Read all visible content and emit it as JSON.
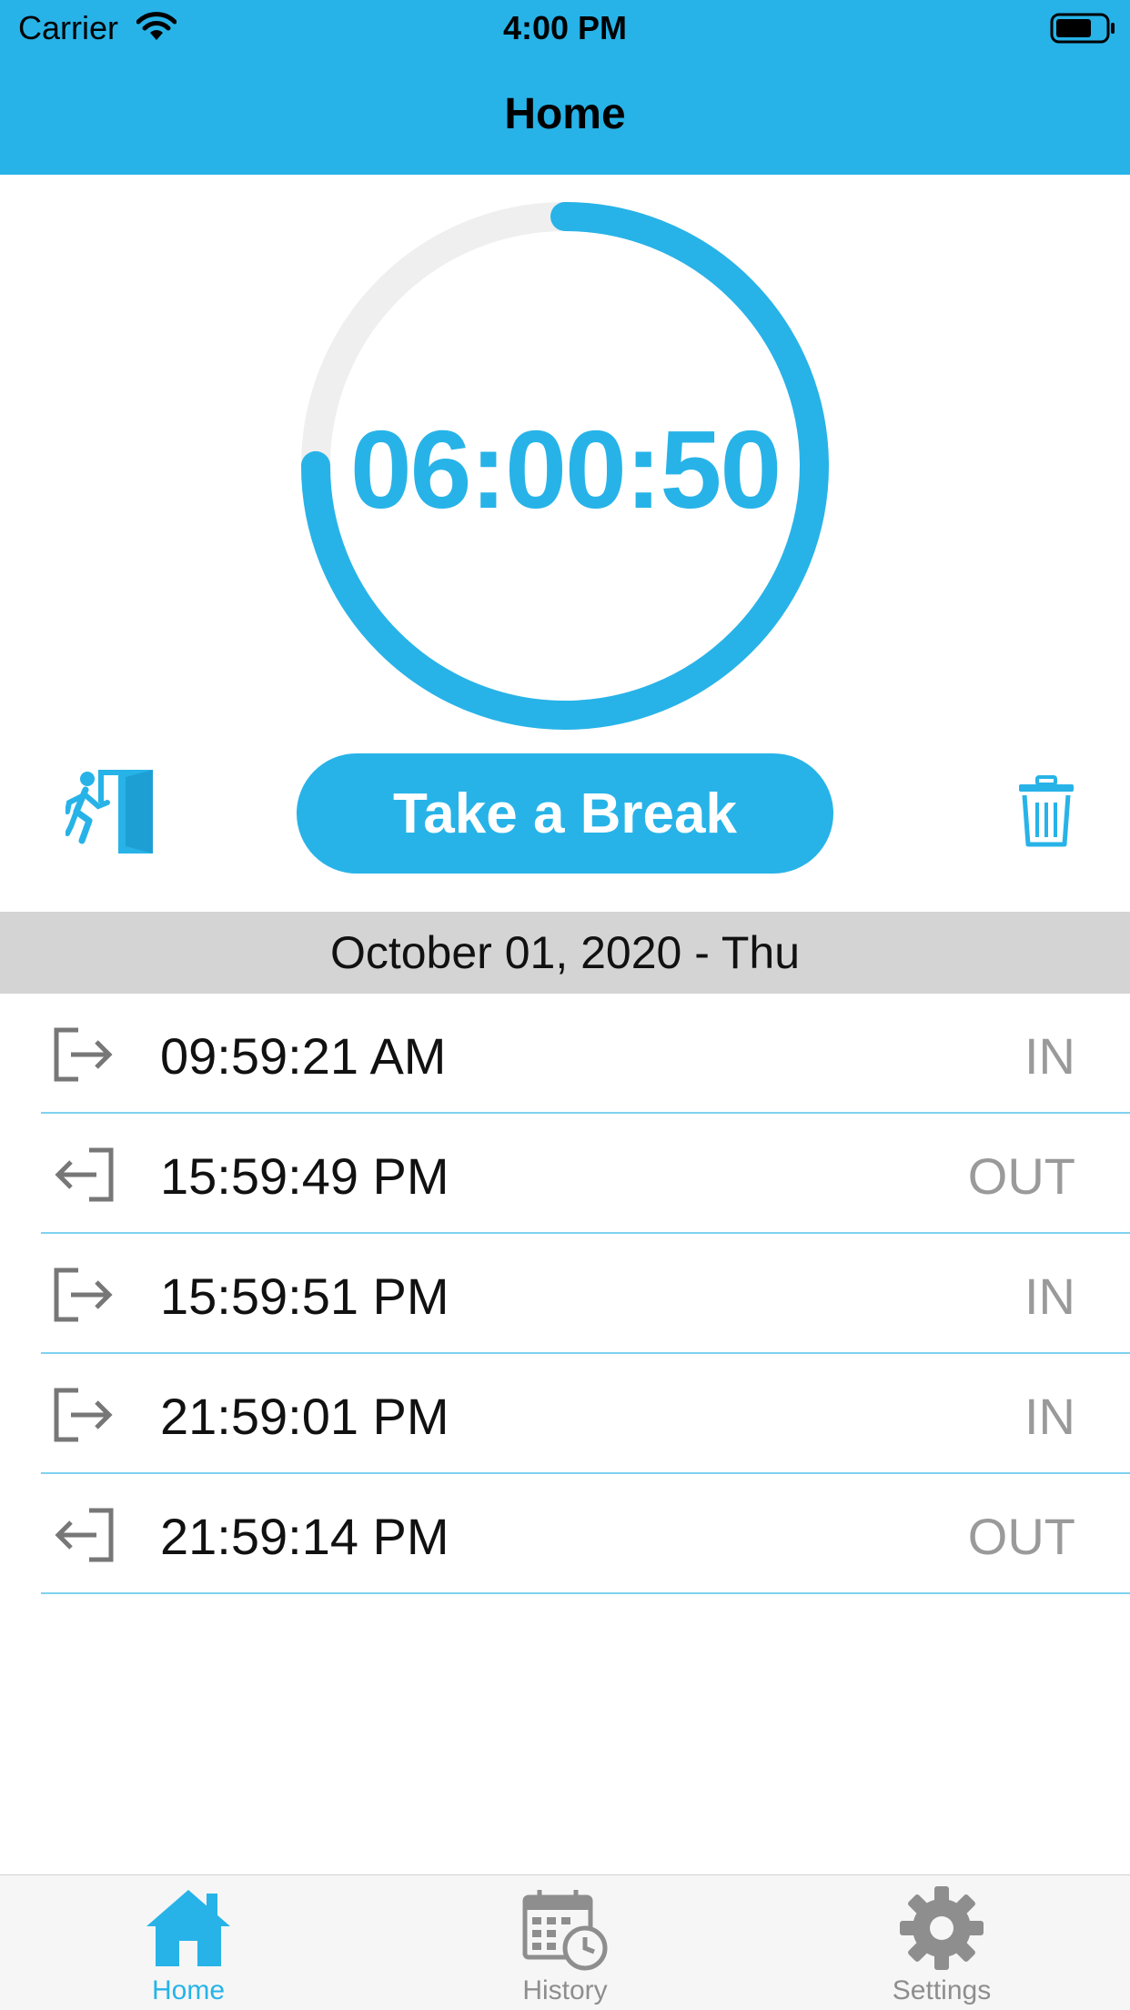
{
  "status_bar": {
    "carrier": "Carrier",
    "time": "4:00 PM",
    "wifi_icon": "wifi-icon",
    "battery_icon": "battery-icon"
  },
  "nav": {
    "title": "Home"
  },
  "timer": {
    "display": "06:00:50",
    "progress": 0.75,
    "accent_color": "#27b3e8",
    "track_color": "#efefef"
  },
  "actions": {
    "exit_icon": "emergency-exit-icon",
    "break_label": "Take a Break",
    "trash_icon": "trash-icon"
  },
  "date_header": "October 01, 2020 - Thu",
  "entries": [
    {
      "time": "09:59:21 AM",
      "type": "IN",
      "icon": "sign-in-icon"
    },
    {
      "time": "15:59:49 PM",
      "type": "OUT",
      "icon": "sign-out-icon"
    },
    {
      "time": "15:59:51 PM",
      "type": "IN",
      "icon": "sign-in-icon"
    },
    {
      "time": "21:59:01 PM",
      "type": "IN",
      "icon": "sign-in-icon"
    },
    {
      "time": "21:59:14 PM",
      "type": "OUT",
      "icon": "sign-out-icon"
    }
  ],
  "tabs": [
    {
      "label": "Home",
      "icon": "home-icon",
      "active": true
    },
    {
      "label": "History",
      "icon": "calendar-clock-icon",
      "active": false
    },
    {
      "label": "Settings",
      "icon": "gear-icon",
      "active": false
    }
  ],
  "colors": {
    "brand": "#27b3e8",
    "separator": "#7fd2ef",
    "date_header_bg": "#d4d4d4",
    "muted_text": "#9a9a9a"
  }
}
